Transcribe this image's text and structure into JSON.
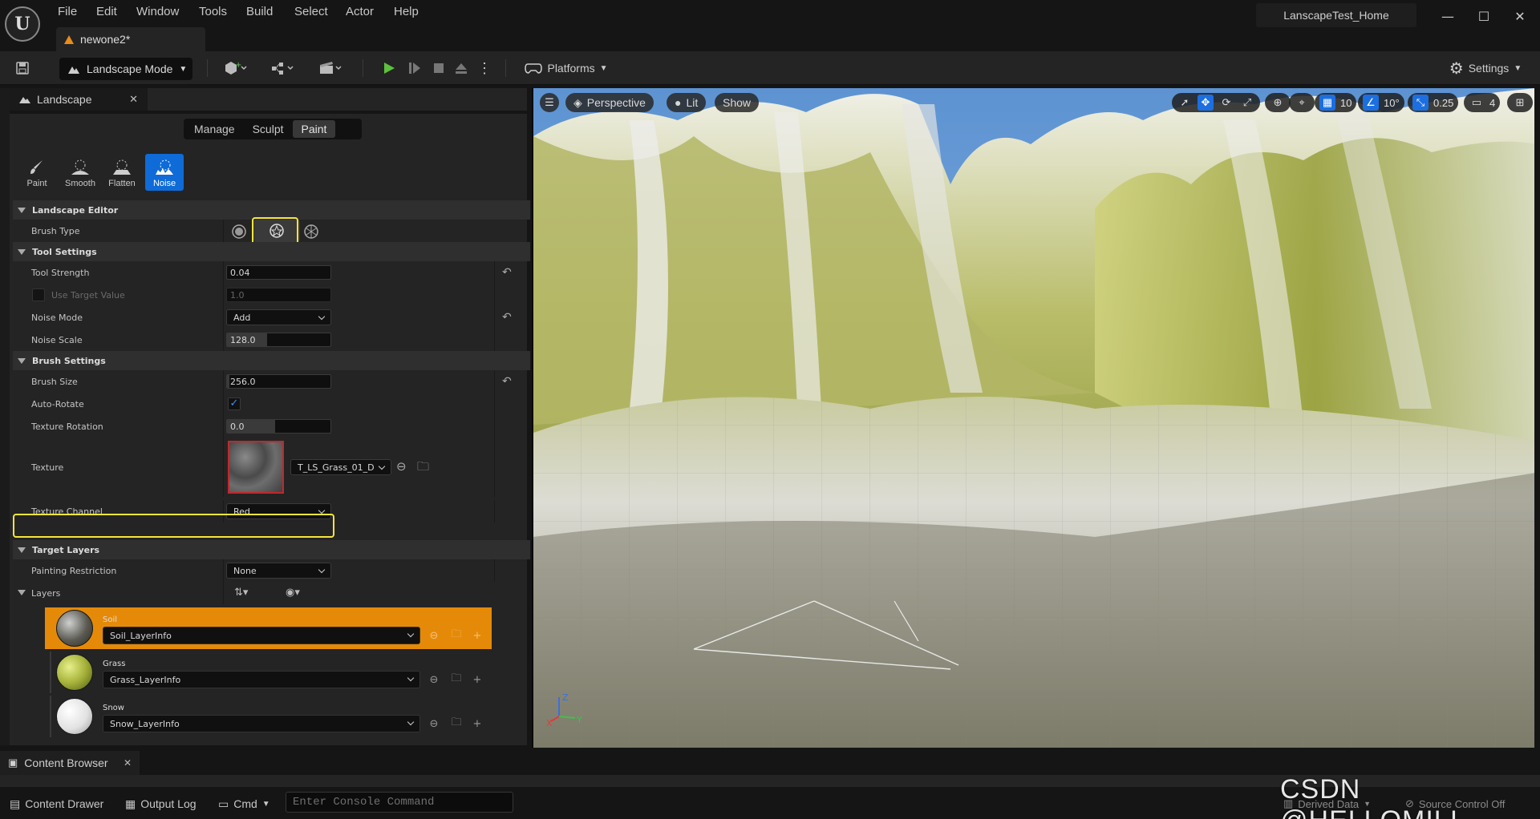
{
  "menu": [
    "File",
    "Edit",
    "Window",
    "Tools",
    "Build",
    "Select",
    "Actor",
    "Help"
  ],
  "project_title": "LanscapeTest_Home",
  "document_tab": "newone2*",
  "toolbar": {
    "mode_label": "Landscape Mode",
    "platforms_label": "Platforms",
    "settings_label": "Settings"
  },
  "panel": {
    "tab_label": "Landscape",
    "modes": [
      "Manage",
      "Sculpt",
      "Paint"
    ],
    "active_mode": "Paint",
    "tools": [
      "Paint",
      "Smooth",
      "Flatten",
      "Noise"
    ],
    "active_tool": "Noise"
  },
  "sections": {
    "landscape_editor": "Landscape Editor",
    "tool_settings": "Tool Settings",
    "brush_settings": "Brush Settings",
    "target_layers": "Target Layers"
  },
  "props": {
    "brush_type_label": "Brush Type",
    "tool_strength_label": "Tool Strength",
    "tool_strength_value": "0.04",
    "use_target_label": "Use Target Value",
    "use_target_value": "1.0",
    "noise_mode_label": "Noise Mode",
    "noise_mode_value": "Add",
    "noise_scale_label": "Noise Scale",
    "noise_scale_value": "128.0",
    "brush_size_label": "Brush Size",
    "brush_size_value": "256.0",
    "auto_rotate_label": "Auto-Rotate",
    "texture_rotation_label": "Texture Rotation",
    "texture_rotation_value": "0.0",
    "texture_label": "Texture",
    "texture_asset": "T_LS_Grass_01_D",
    "texture_channel_label": "Texture Channel",
    "texture_channel_value": "Red",
    "painting_restriction_label": "Painting Restriction",
    "painting_restriction_value": "None",
    "layers_label": "Layers"
  },
  "layers": [
    {
      "name": "Soil",
      "info": "Soil_LayerInfo"
    },
    {
      "name": "Grass",
      "info": "Grass_LayerInfo"
    },
    {
      "name": "Snow",
      "info": "Snow_LayerInfo"
    }
  ],
  "viewport": {
    "perspective": "Perspective",
    "lit": "Lit",
    "show": "Show",
    "grid_snap": "10",
    "rot_snap": "10°",
    "scale_snap": "0.25",
    "camera_speed": "4"
  },
  "bottom": {
    "content_browser": "Content Browser",
    "content_drawer": "Content Drawer",
    "output_log": "Output Log",
    "cmd": "Cmd",
    "console_placeholder": "Enter Console Command",
    "derived_data": "Derived Data",
    "source_control": "Source Control Off",
    "watermark": "CSDN @HELLOMILI"
  },
  "colors": {
    "accent_blue": "#0e6bd8",
    "selected_layer": "#e58a08",
    "highlight": "#f7e53b"
  }
}
